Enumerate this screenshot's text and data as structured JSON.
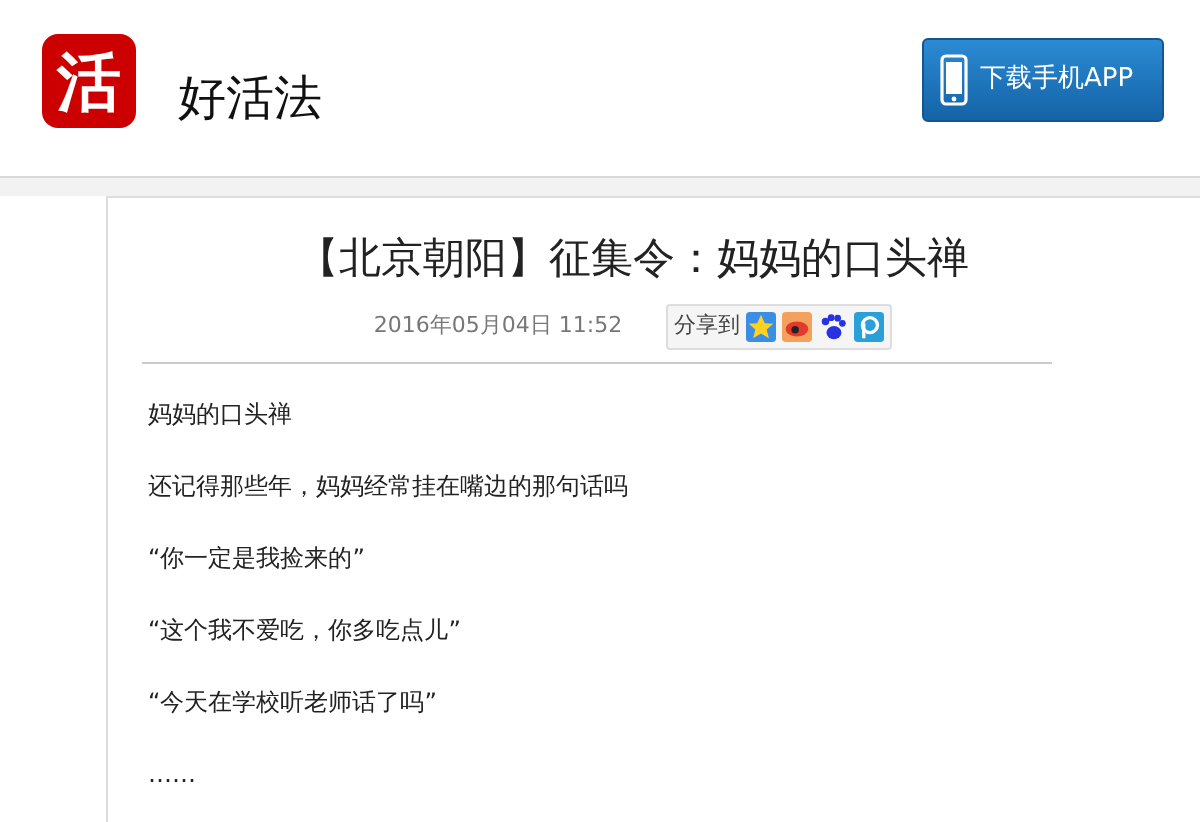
{
  "header": {
    "logo_glyph": "活",
    "site_name": "好活法",
    "download_button": "下载手机APP"
  },
  "article": {
    "title": "【北京朝阳】征集令：妈妈的口头禅",
    "date": "2016年05月04日 11:52",
    "share_label": "分享到",
    "paragraphs": [
      "妈妈的口头禅",
      "还记得那些年，妈妈经常挂在嘴边的那句话吗",
      "“你一定是我捡来的”",
      "“这个我不爱吃，你多吃点儿”",
      "“今天在学校听老师话了吗”",
      "……"
    ]
  }
}
